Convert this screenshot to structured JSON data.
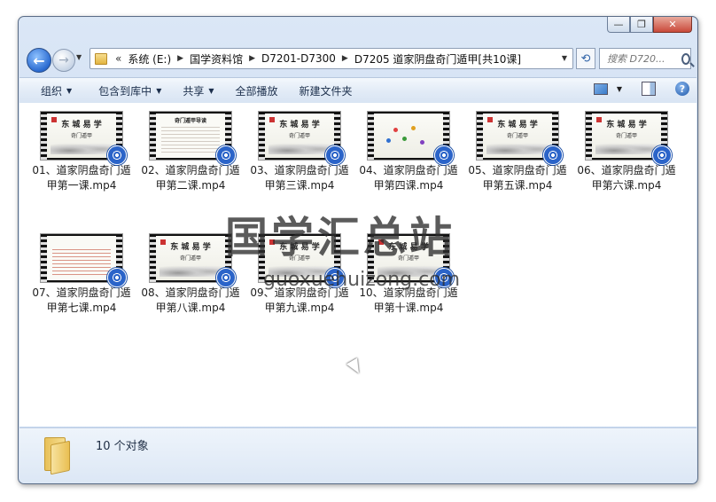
{
  "window": {
    "minimize_glyph": "—",
    "maximize_glyph": "❐",
    "close_glyph": "✕"
  },
  "nav": {
    "back_glyph": "←",
    "forward_glyph": "→"
  },
  "address": {
    "overflow": "«",
    "crumbs": [
      "系统 (E:)",
      "国学资料馆",
      "D7201-D7300",
      "D7205 道家阴盘奇门遁甲[共10课]"
    ]
  },
  "search": {
    "placeholder": "搜索 D720..."
  },
  "toolbar": {
    "organize": "组织",
    "include_in_library": "包含到库中",
    "share": "共享",
    "play_all": "全部播放",
    "new_folder": "新建文件夹"
  },
  "files": [
    {
      "name": "01、道家阴盘奇门遁甲第一课.mp4",
      "thumb_title": "东 城 易 学",
      "thumb_sub": "奇门遁甲"
    },
    {
      "name": "02、道家阴盘奇门遁甲第二课.mp4",
      "thumb_title": "奇门遁甲导读",
      "thumb_sub": ""
    },
    {
      "name": "03、道家阴盘奇门遁甲第三课.mp4",
      "thumb_title": "东 城 易 学",
      "thumb_sub": "奇门遁甲"
    },
    {
      "name": "04、道家阴盘奇门遁甲第四课.mp4",
      "thumb_title": "",
      "thumb_sub": ""
    },
    {
      "name": "05、道家阴盘奇门遁甲第五课.mp4",
      "thumb_title": "东 城 易 学",
      "thumb_sub": "奇门遁甲"
    },
    {
      "name": "06、道家阴盘奇门遁甲第六课.mp4",
      "thumb_title": "东 城 易 学",
      "thumb_sub": "奇门遁甲"
    },
    {
      "name": "07、道家阴盘奇门遁甲第七课.mp4",
      "thumb_title": "",
      "thumb_sub": ""
    },
    {
      "name": "08、道家阴盘奇门遁甲第八课.mp4",
      "thumb_title": "东 城 易 学",
      "thumb_sub": "奇门遁甲"
    },
    {
      "name": "09、道家阴盘奇门遁甲第九课.mp4",
      "thumb_title": "东 城 易 学",
      "thumb_sub": "奇门遁甲"
    },
    {
      "name": "10、道家阴盘奇门遁甲第十课.mp4",
      "thumb_title": "东 城 易 学",
      "thumb_sub": "奇门遁甲"
    }
  ],
  "status": {
    "item_count": "10 个对象"
  },
  "watermark": {
    "title": "国学汇总站",
    "url": "guoxuehuizong.com"
  }
}
